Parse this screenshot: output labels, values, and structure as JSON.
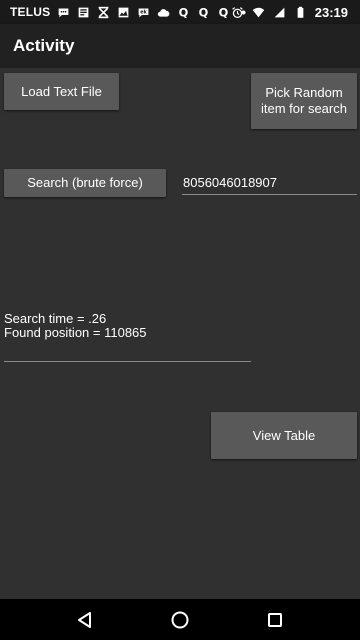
{
  "status_bar": {
    "carrier": "TELUS",
    "notification_icons": [
      "messenger-icon",
      "news-icon",
      "x-icon",
      "image-icon",
      "eks-icon",
      "cloud-icon",
      "q-icon",
      "q-icon",
      "q-icon",
      "dot-icon"
    ],
    "q_label": "Q",
    "time": "23:19"
  },
  "app_bar": {
    "title": "Activity"
  },
  "buttons": {
    "load_text_file": "Load Text File",
    "pick_random": "Pick Random item for search",
    "search_brute_force": "Search (brute force)",
    "view_table": "View Table"
  },
  "search_field": {
    "value": "8056046018907"
  },
  "results": {
    "search_time": "Search time = .26",
    "found_position": "Found position = 110865"
  },
  "colors": {
    "background": "#303030",
    "app_bar": "#212121",
    "button": "#595959"
  }
}
